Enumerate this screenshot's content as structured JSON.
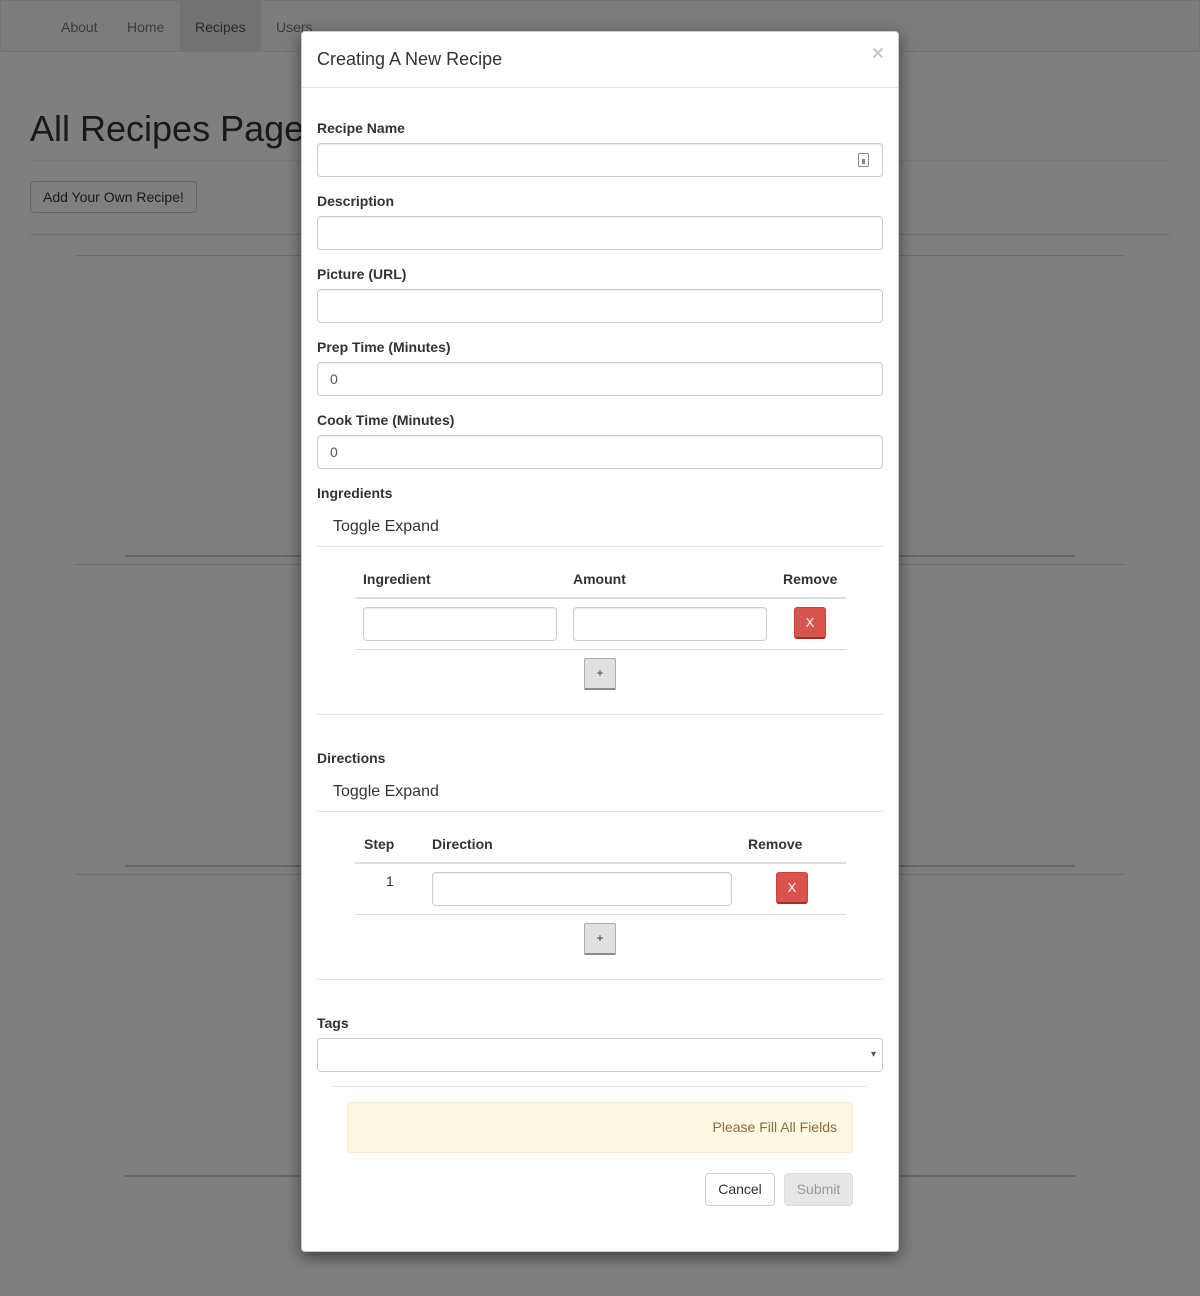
{
  "nav": {
    "items": [
      {
        "label": "About"
      },
      {
        "label": "Home"
      },
      {
        "label": "Recipes"
      },
      {
        "label": "Users"
      }
    ]
  },
  "page": {
    "title": "All Recipes Page",
    "add_button": "Add Your Own Recipe!"
  },
  "modal": {
    "title": "Creating A New Recipe",
    "close": "×",
    "fields": {
      "recipe_name_label": "Recipe Name",
      "recipe_name_value": "",
      "description_label": "Description",
      "description_value": "",
      "picture_label": "Picture (URL)",
      "picture_value": "",
      "prep_label": "Prep Time (Minutes)",
      "prep_value": "0",
      "cook_label": "Cook Time (Minutes)",
      "cook_value": "0"
    },
    "ingredients": {
      "label": "Ingredients",
      "toggle": "Toggle Expand",
      "headers": {
        "ingredient": "Ingredient",
        "amount": "Amount",
        "remove": "Remove"
      },
      "remove_label": "X",
      "add_label": "+"
    },
    "directions": {
      "label": "Directions",
      "toggle": "Toggle Expand",
      "headers": {
        "step": "Step",
        "direction": "Direction",
        "remove": "Remove"
      },
      "rows": [
        {
          "step": "1"
        }
      ],
      "remove_label": "X",
      "add_label": "+"
    },
    "tags": {
      "label": "Tags",
      "caret": "▾"
    },
    "alert": "Please Fill All Fields",
    "cancel": "Cancel",
    "submit": "Submit"
  }
}
